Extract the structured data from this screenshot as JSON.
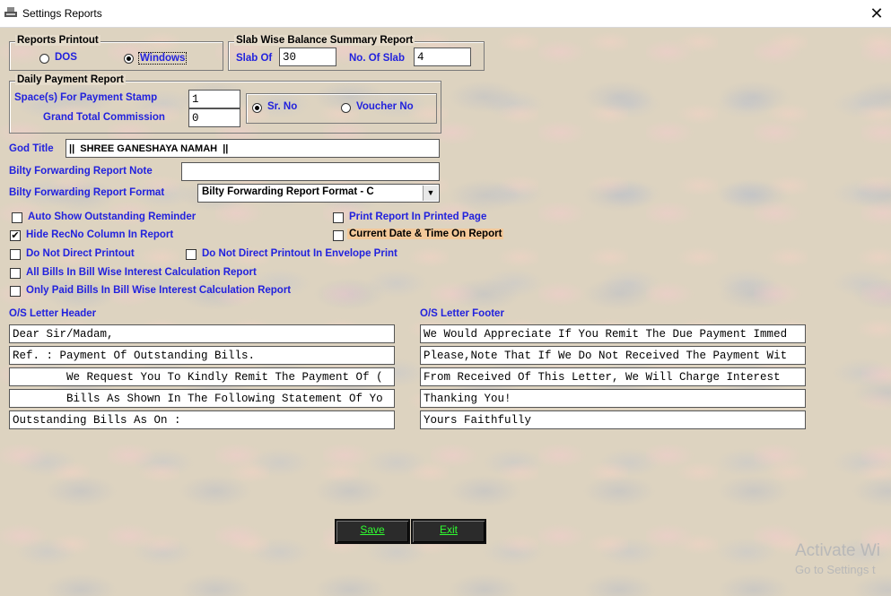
{
  "window": {
    "title": "Settings Reports"
  },
  "reports_printout": {
    "title": "Reports Printout",
    "options": [
      "DOS",
      "Windows"
    ],
    "selected": "Windows"
  },
  "slab": {
    "title": "Slab Wise Balance Summary Report",
    "slab_of_label": "Slab Of",
    "slab_of_value": "30",
    "no_of_slab_label": "No. Of Slab",
    "no_of_slab_value": "4"
  },
  "daily_payment": {
    "title": "Daily Payment Report",
    "space_label": "Space(s) For Payment Stamp",
    "space_value": "1",
    "commission_label": "Grand Total Commission",
    "commission_value": "0",
    "options": [
      "Sr. No",
      "Voucher No"
    ],
    "selected": "Sr. No"
  },
  "god_title": {
    "label": "God Title",
    "value": "||  SHREE GANESHAYA NAMAH  ||"
  },
  "bilty_note": {
    "label": "Bilty Forwarding Report Note",
    "value": ""
  },
  "bilty_format": {
    "label": "Bilty Forwarding Report Format",
    "value": "Bilty Forwarding Report Format - C"
  },
  "checkboxes": [
    {
      "label": "Auto Show Outstanding Reminder",
      "checked": false
    },
    {
      "label": "Print Report In Printed Page",
      "checked": false
    },
    {
      "label": "Hide RecNo Column In Report",
      "checked": true
    },
    {
      "label": "Current Date & Time On Report",
      "checked": false
    },
    {
      "label": "Do Not Direct Printout",
      "checked": false
    },
    {
      "label": "Do Not Direct Printout In Envelope Print",
      "checked": false
    },
    {
      "label": "All Bills In Bill Wise Interest Calculation Report",
      "checked": false
    },
    {
      "label": "Only Paid Bills In Bill Wise Interest Calculation Report",
      "checked": false
    }
  ],
  "letter_header": {
    "label": "O/S Letter Header",
    "lines": [
      "Dear Sir/Madam,",
      "Ref. : Payment Of Outstanding Bills.",
      "        We Request You To Kindly Remit The Payment Of (",
      "        Bills As Shown In The Following Statement Of Yo",
      "Outstanding Bills As On :"
    ]
  },
  "letter_footer": {
    "label": "O/S Letter Footer",
    "lines": [
      "We Would Appreciate If You Remit The Due Payment Immed",
      "Please,Note That If We Do Not Received The Payment Wit",
      "From Received Of This Letter, We Will Charge Interest",
      "Thanking You!",
      "Yours Faithfully"
    ]
  },
  "buttons": {
    "save": "Save",
    "exit": "Exit"
  },
  "watermark": {
    "line1": "Activate Wi",
    "line2": "Go to Settings t"
  }
}
